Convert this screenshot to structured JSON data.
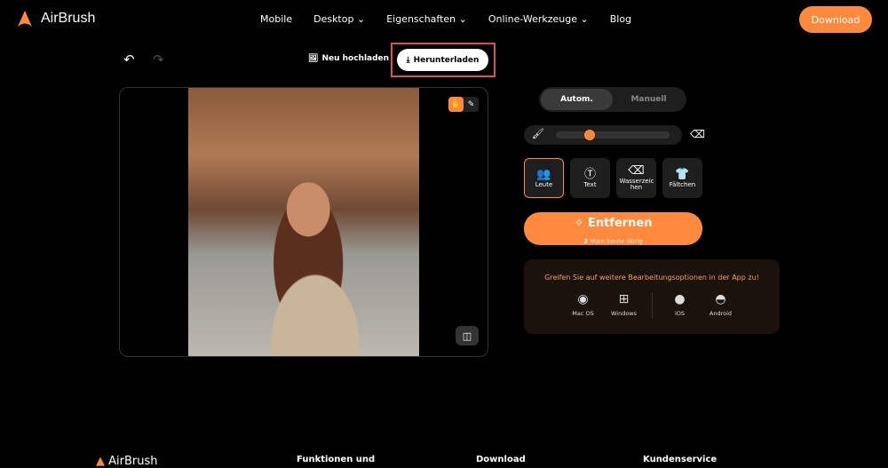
{
  "header": {
    "brand": "AirBrush",
    "nav": [
      "Mobile",
      "Desktop",
      "Eigenschaften",
      "Online-Werkzeuge",
      "Blog"
    ],
    "nav_dropdowns": [
      false,
      true,
      true,
      true,
      false
    ],
    "download": "Download"
  },
  "toolbar": {
    "upload": "Neu hochladen",
    "download": "Herunterladen"
  },
  "mode": {
    "auto": "Autom.",
    "manual": "Manuell",
    "selected": "Autom."
  },
  "brush_size": 0.3,
  "categories": [
    {
      "label": "Leute",
      "icon": "people-icon",
      "selected": true
    },
    {
      "label": "Text",
      "icon": "text-icon"
    },
    {
      "label": "Wasserzeichen",
      "display": "Wasserzeic hen",
      "icon": "eraser-icon"
    },
    {
      "label": "Fältchen",
      "icon": "shirt-icon"
    }
  ],
  "remove": {
    "label": "Entfernen",
    "count": "2",
    "remaining": "Male heute übrig"
  },
  "promo": {
    "text": "Greifen Sie auf weitere Bearbeitungsoptionen in der App zu!",
    "apps": [
      "Mac OS",
      "Windows",
      "iOS",
      "Android"
    ]
  },
  "footer": {
    "brand": "AirBrush",
    "cols": [
      "Funktionen und",
      "Download",
      "Kundenservice"
    ]
  },
  "colors": {
    "accent": "#ff8a3d",
    "highlight": "#d9534f"
  }
}
